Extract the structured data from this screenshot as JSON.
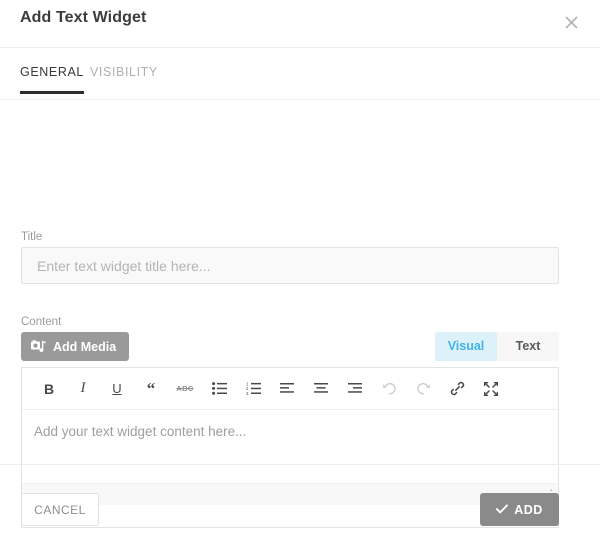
{
  "dialog": {
    "title": "Add Text Widget",
    "close_icon": "close-icon"
  },
  "tabs": [
    {
      "label": "GENERAL",
      "active": true
    },
    {
      "label": "VISIBILITY",
      "active": false
    }
  ],
  "form": {
    "title_field": {
      "label": "Title",
      "value": "",
      "placeholder": "Enter text widget title here..."
    },
    "content_field": {
      "label": "Content",
      "add_media_label": "Add Media",
      "add_media_icon": "add-media-icon",
      "editor_placeholder": "Add your text widget content here...",
      "mode_tabs": [
        {
          "label": "Visual",
          "active": true
        },
        {
          "label": "Text",
          "active": false
        }
      ],
      "toolbar": [
        {
          "name": "bold",
          "glyph": "B"
        },
        {
          "name": "italic",
          "glyph": "I"
        },
        {
          "name": "underline",
          "glyph": "U"
        },
        {
          "name": "blockquote",
          "glyph": "“"
        },
        {
          "name": "strikethrough",
          "glyph": "ABC"
        },
        {
          "name": "bulleted-list",
          "glyph": ""
        },
        {
          "name": "numbered-list",
          "glyph": ""
        },
        {
          "name": "align-left",
          "glyph": ""
        },
        {
          "name": "align-center",
          "glyph": ""
        },
        {
          "name": "align-right",
          "glyph": ""
        },
        {
          "name": "undo",
          "glyph": ""
        },
        {
          "name": "redo",
          "glyph": ""
        },
        {
          "name": "insert-link",
          "glyph": ""
        },
        {
          "name": "fullscreen",
          "glyph": ""
        }
      ]
    }
  },
  "footer": {
    "cancel_label": "CANCEL",
    "add_label": "ADD",
    "add_icon": "check-icon"
  },
  "colors": {
    "accent_blue": "#41b3e8",
    "accent_blue_bg": "#ddf1fb",
    "button_gray": "#8a8a8a",
    "media_button_gray": "#9a9a9a",
    "tab_active_underline": "#2e2e2e",
    "border": "#e4e4e4"
  }
}
